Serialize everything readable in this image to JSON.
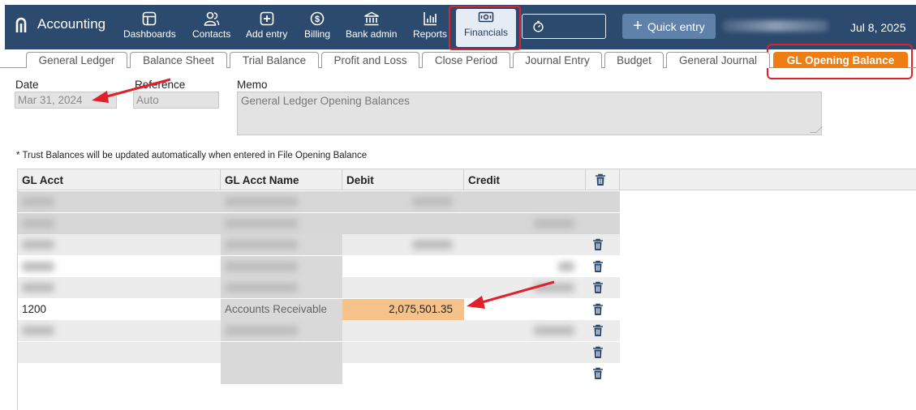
{
  "app": {
    "title": "Accounting"
  },
  "nav": [
    {
      "id": "dashboards",
      "label": "Dashboards",
      "icon": "dashboard-icon"
    },
    {
      "id": "contacts",
      "label": "Contacts",
      "icon": "contacts-icon"
    },
    {
      "id": "add-entry",
      "label": "Add entry",
      "icon": "add-entry-icon"
    },
    {
      "id": "billing",
      "label": "Billing",
      "icon": "dollar-icon"
    },
    {
      "id": "bank-admin",
      "label": "Bank admin",
      "icon": "bank-icon"
    },
    {
      "id": "reports",
      "label": "Reports",
      "icon": "bar-chart-icon"
    },
    {
      "id": "financials",
      "label": "Financials",
      "icon": "money-icon",
      "active": true
    }
  ],
  "header": {
    "quick_entry_label": "Quick entry",
    "date": "Jul 8, 2025"
  },
  "tabs": [
    {
      "label": "General Ledger"
    },
    {
      "label": "Balance Sheet"
    },
    {
      "label": "Trial Balance"
    },
    {
      "label": "Profit and Loss"
    },
    {
      "label": "Close Period"
    },
    {
      "label": "Journal Entry"
    },
    {
      "label": "Budget"
    },
    {
      "label": "General Journal"
    },
    {
      "label": "GL Opening Balance",
      "active": true
    }
  ],
  "form": {
    "date_label": "Date",
    "date_value": "Mar 31, 2024",
    "reference_label": "Reference",
    "reference_value": "Auto",
    "memo_label": "Memo",
    "memo_value": "General Ledger Opening Balances",
    "note": "* Trust Balances will be updated automatically when entered in File Opening Balance"
  },
  "grid": {
    "columns": [
      "GL Acct",
      "GL Acct Name",
      "Debit",
      "Credit"
    ],
    "rows": [
      {
        "acct": "",
        "name": "",
        "debit": "",
        "credit": "",
        "blurred": true
      },
      {
        "acct": "",
        "name": "",
        "debit": "",
        "credit": "",
        "blurred": true
      },
      {
        "acct": "",
        "name": "",
        "debit": "",
        "credit": "",
        "blurred": true
      },
      {
        "acct": "",
        "name": "",
        "debit": "",
        "credit": "",
        "blurred": true
      },
      {
        "acct": "",
        "name": "",
        "debit": "",
        "credit": "",
        "blurred": true
      },
      {
        "acct": "1200",
        "name": "Accounts Receivable",
        "debit": "2,075,501.35",
        "credit": "",
        "blurred": false,
        "highlight": true
      },
      {
        "acct": "",
        "name": "",
        "debit": "",
        "credit": "",
        "blurred": true
      },
      {
        "acct": "",
        "name": "",
        "debit": "",
        "credit": "",
        "blurred": false
      },
      {
        "acct": "",
        "name": "",
        "debit": "",
        "credit": "",
        "blurred": false
      }
    ]
  },
  "colors": {
    "topbar": "#2c4a6e",
    "active_tab": "#ef7d12",
    "highlight_cell": "#f5c38a",
    "annotation_red": "#e0212b",
    "trash": "#2c4a6e"
  }
}
